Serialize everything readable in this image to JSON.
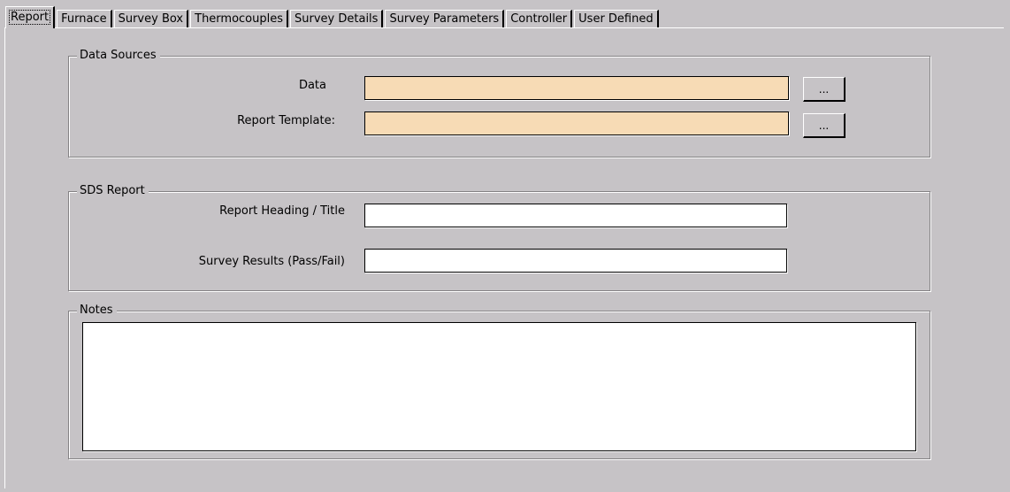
{
  "tabs": [
    {
      "label": "Report",
      "active": true
    },
    {
      "label": "Furnace",
      "active": false
    },
    {
      "label": "Survey Box",
      "active": false
    },
    {
      "label": "Thermocouples",
      "active": false
    },
    {
      "label": "Survey Details",
      "active": false
    },
    {
      "label": "Survey Parameters",
      "active": false
    },
    {
      "label": "Controller",
      "active": false
    },
    {
      "label": "User Defined",
      "active": false
    }
  ],
  "data_sources": {
    "title": "Data Sources",
    "data_label": "Data",
    "data_value": "",
    "data_browse_label": "...",
    "template_label": "Report Template:",
    "template_value": "",
    "template_browse_label": "..."
  },
  "sds_report": {
    "title": "SDS Report",
    "heading_label": "Report Heading / Title",
    "heading_value": "",
    "results_label": "Survey Results (Pass/Fail)",
    "results_value": ""
  },
  "notes": {
    "title": "Notes",
    "value": ""
  },
  "colors": {
    "window_bg": "#c6c3c6",
    "required_field_bg": "#f7dbb5",
    "field_bg": "#ffffff"
  }
}
